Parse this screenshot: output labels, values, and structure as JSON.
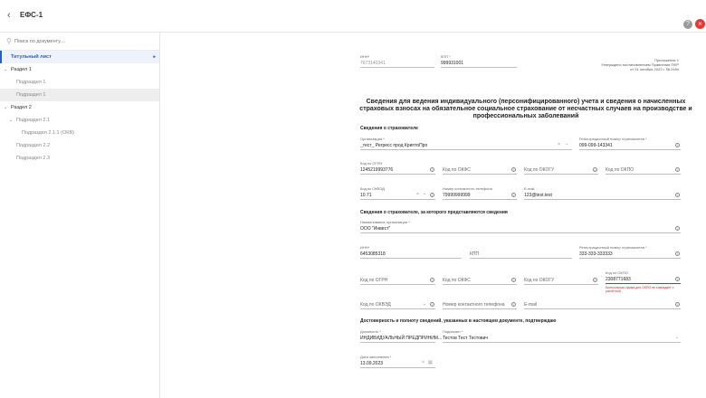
{
  "header": {
    "back_icon": "arrow-left-icon",
    "title": "ЕФС-1",
    "help_icon": "question-icon",
    "close_icon": "close-icon"
  },
  "sidebar": {
    "search_placeholder": "Поиск по документу…",
    "items": [
      {
        "label": "Титульный лист"
      },
      {
        "label": "Раздел 1"
      },
      {
        "label": "Подраздел 1"
      },
      {
        "label": "Подраздел 1"
      },
      {
        "label": "Раздел 2"
      },
      {
        "label": "Подраздел 2.1"
      },
      {
        "label": "Подраздел 2.1.1 (ОКВ)"
      },
      {
        "label": "Подраздел 2.2"
      },
      {
        "label": "Подраздел 2.3"
      }
    ]
  },
  "form": {
    "inn_label": "ИНН*",
    "inn_value": "7673140341",
    "kpp_label": "КПП *",
    "kpp_value": "999931001",
    "appendix": [
      "Приложение 1",
      "Утверждено постановлением Правления ПФР",
      "от 31 октября 2022 г. № 245п"
    ],
    "title": "Сведения для ведения индивидуального (персонифицированного) учета и сведения о начисленных страховых взносах на обязательное социальное страхование от несчастных случаев на производстве и профессиональных заболеваний",
    "insurer": {
      "heading": "Сведения о страхователе",
      "org_label": "Организация *",
      "org_value": "_тест_ Регресс прод КриптоПро",
      "reg_label": "Регистрационный номер страхователя *",
      "reg_value": "099-099-143341",
      "ogrn_label": "Код по ОГРН",
      "ogrn_value": "1245219993776",
      "okfs": "Код по ОКФС",
      "okogu": "Код по ОКОГУ",
      "okopf": "Код по ОКПО",
      "okved_label": "Код по ОКВЭД",
      "okved_value": "10.71",
      "phone_label": "Номер контактного телефона",
      "phone_value": "79999999999",
      "email_label": "E-mail",
      "email_value": "123@test.test"
    },
    "subject": {
      "heading": "Сведения о страхователе, за которого представляются сведения",
      "org_label": "Наименование организации *",
      "org_value": "ООО \"Инвест\"",
      "inn_label": "ИНН*",
      "inn_value": "6453085318",
      "kpp": "КПП",
      "reg_label": "Регистрационный номер страхователя *",
      "reg_value": "333-333-333333",
      "ogrn": "Код по ОГРН",
      "okfs": "Код по ОКФС",
      "okogu": "Код по ОКОГУ",
      "okpo_label": "Код по ОКПО",
      "okpo_value": "2308771683",
      "okpo_error": "Контрольная сумма для ОКПО не совпадает с расчетной",
      "okved": "Код по ОКВЭД",
      "phone": "Номер контактного телефона",
      "email": "E-mail"
    },
    "confirm": {
      "heading": "Достоверность и полноту сведений, указанных в настоящем документе, подтверждаю",
      "position_label": "Должность *",
      "position_value": "ИНДИВИДУАЛЬНЫЙ ПРЕДПРИНИМ...",
      "signer_label": "Подписант *",
      "signer_value": "Тестов Тест Тестович",
      "date_label": "Дата заполнения *",
      "date_value": "13.09.2023"
    }
  }
}
